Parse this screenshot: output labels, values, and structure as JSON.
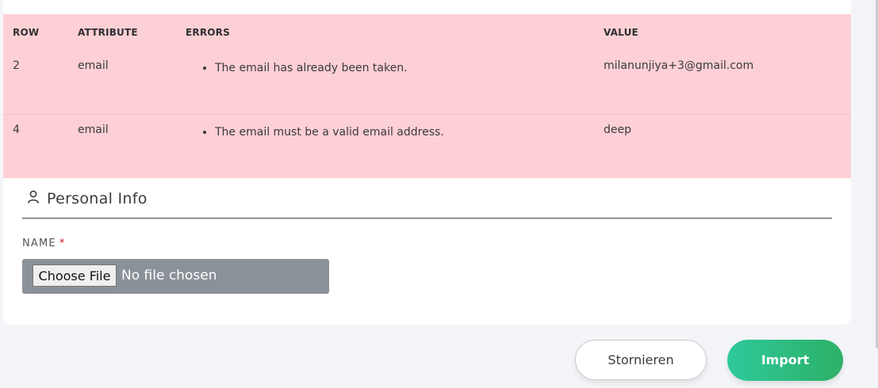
{
  "errors_table": {
    "headers": {
      "row": "ROW",
      "attribute": "ATTRIBUTE",
      "errors": "ERRORS",
      "value": "VALUE"
    },
    "rows": [
      {
        "row": "2",
        "attribute": "email",
        "errors": [
          "The email has already been taken."
        ],
        "value": "milanunjiya+3@gmail.com"
      },
      {
        "row": "4",
        "attribute": "email",
        "errors": [
          "The email must be a valid email address."
        ],
        "value": "deep"
      }
    ],
    "row_bg": "#fdd0d6"
  },
  "section": {
    "icon": "person-icon",
    "title": "Personal Info"
  },
  "field": {
    "label": "NAME",
    "required_mark": "*",
    "choose_button": "Choose File",
    "no_file_text": "No file chosen"
  },
  "actions": {
    "cancel": "Stornieren",
    "import": "Import",
    "import_color": "#2fbf85"
  }
}
